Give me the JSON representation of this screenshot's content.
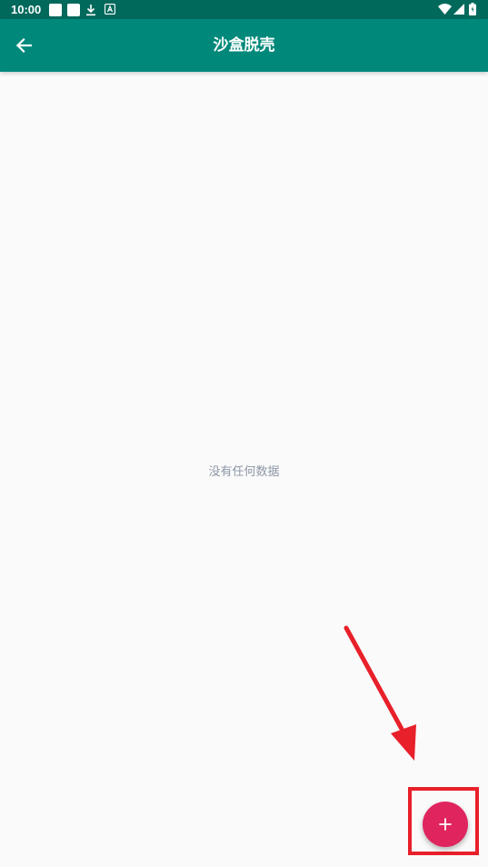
{
  "status_bar": {
    "time": "10:00"
  },
  "app_bar": {
    "title": "沙盒脱壳",
    "back_icon": "arrow-back-icon"
  },
  "content": {
    "empty_message": "没有任何数据"
  },
  "fab": {
    "icon": "plus-icon"
  },
  "colors": {
    "status_bar": "#00695c",
    "app_bar": "#00897b",
    "fab": "#e0245e",
    "annotation": "#e8202a",
    "empty_text": "#8c96a6"
  }
}
